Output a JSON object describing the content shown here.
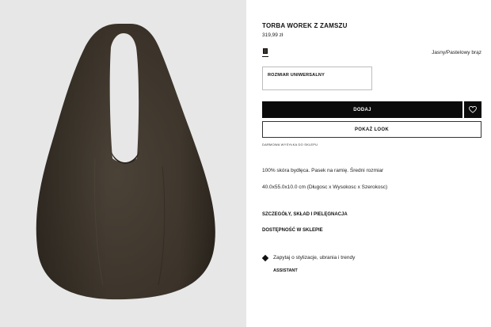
{
  "product": {
    "title": "TORBA WOREK Z ZAMSZU",
    "price": "319,99 zł",
    "color_name": "Jasny/Pastelowy brąz",
    "size_label": "ROZMIAR UNIWERSALNY",
    "shipping_note": "DARMOWA WYSYŁKA DO SKLEPU",
    "description_1": "100% skóra bydlęca. Pasek na ramię. Średni rozmiar",
    "description_2": "40.0x55.0x10.0 cm (Długosc x Wysokosc x Szerokosc)"
  },
  "actions": {
    "add_label": "DODAJ",
    "look_label": "POKAŻ LOOK",
    "wishlist_icon": "heart-icon"
  },
  "links": {
    "details": "SZCZEGÓŁY, SKŁAD I PIELĘGNACJA",
    "availability": "DOSTĘPNOŚĆ W SKLEPIE"
  },
  "assistant": {
    "prompt": "Zapytaj o stylizacje, ubrania i trendy",
    "label": "ASSISTANT",
    "icon": "diamond-icon"
  },
  "colors": {
    "bag": "#3d362d",
    "gallery_bg": "#e7e7e7",
    "button_bg": "#0b0b0b"
  }
}
